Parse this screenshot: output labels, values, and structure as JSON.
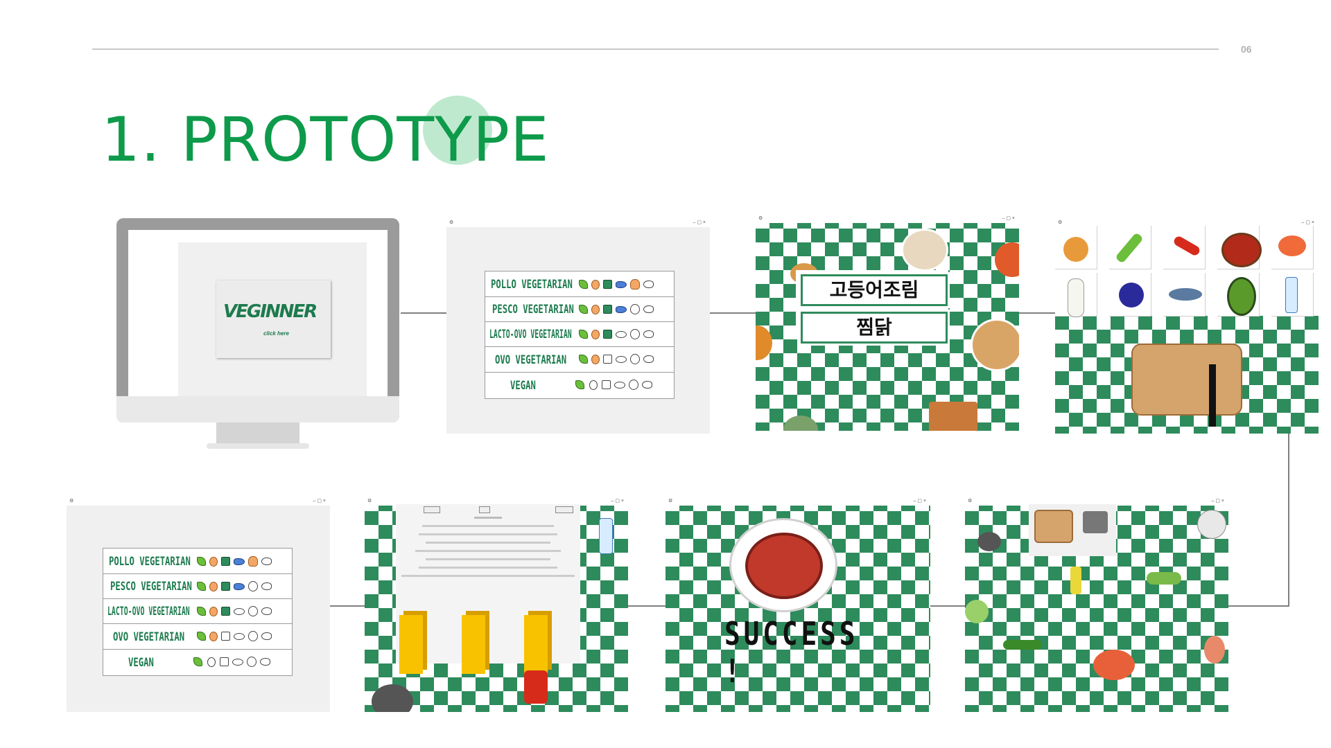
{
  "page": {
    "number": "06",
    "title": "1. PROTOTYPE"
  },
  "screens": {
    "splash": {
      "logo": "VEGINNER",
      "click_label": "click here"
    },
    "diet_menu": {
      "rows": [
        {
          "label": "POLLO VEGETARIAN"
        },
        {
          "label": "PESCO VEGETARIAN"
        },
        {
          "label": "LACTO-OVO VEGETARIAN"
        },
        {
          "label": "OVO VEGETARIAN"
        },
        {
          "label": "VEGAN"
        }
      ]
    },
    "dish_menu": {
      "dish_1": "고등어조림",
      "dish_2": "찜닭"
    },
    "result": {
      "text": "SUCCESS !"
    }
  },
  "colors": {
    "brand_green": "#0d9a4a",
    "checker_green": "#2e8b5c",
    "title_circle": "#a9e2bf",
    "pillar_yellow": "#f8c200"
  }
}
